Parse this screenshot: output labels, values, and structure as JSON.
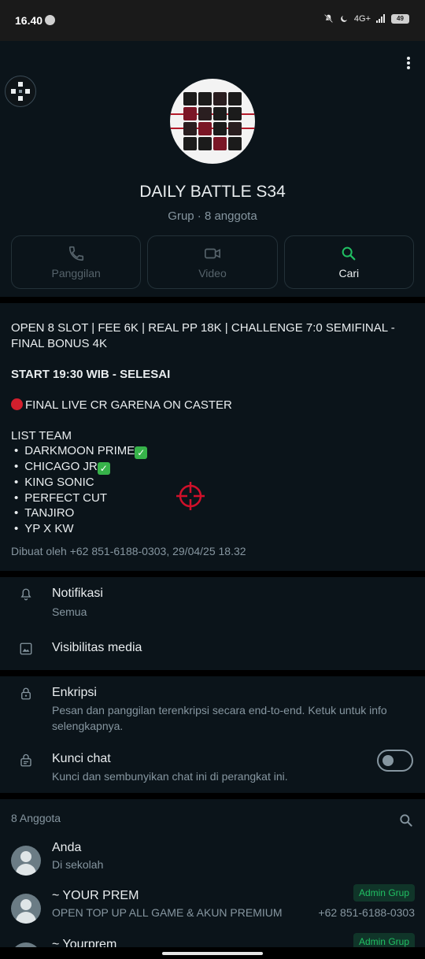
{
  "status_bar": {
    "time": "16.40",
    "battery": "49",
    "network": "4G+"
  },
  "header": {
    "group_name": "DAILY BATTLE S34",
    "group_sub": "Grup · 8 anggota"
  },
  "actions": [
    {
      "label": "Panggilan",
      "icon": "phone-icon",
      "enabled": false
    },
    {
      "label": "Video",
      "icon": "video-icon",
      "enabled": false
    },
    {
      "label": "Cari",
      "icon": "search-icon",
      "enabled": true
    }
  ],
  "description": {
    "line1": "OPEN 8 SLOT | FEE 6K | REAL PP 18K | CHALLENGE 7:0 SEMIFINAL - FINAL BONUS 4K",
    "start": "START 19:30 WIB - SELESAI",
    "final_live": "FINAL LIVE CR GARENA ON CASTER",
    "list_title": "LIST TEAM",
    "teams": [
      "DARKMOON PRIME",
      "CHICAGO JR",
      "KING SONIC",
      "PERFECT CUT",
      "TANJIRO",
      "YP X KW"
    ],
    "created_by": "Dibuat oleh +62 851-6188-0303, 29/04/25 18.32"
  },
  "settings": {
    "notifications": {
      "title": "Notifikasi",
      "sub": "Semua"
    },
    "media_visibility": {
      "title": "Visibilitas media"
    },
    "encryption": {
      "title": "Enkripsi",
      "sub": "Pesan dan panggilan terenkripsi secara end-to-end. Ketuk untuk info selengkapnya."
    },
    "chat_lock": {
      "title": "Kunci chat",
      "sub": "Kunci dan sembunyikan chat ini di perangkat ini.",
      "enabled": false
    }
  },
  "members": {
    "heading": "8 Anggota",
    "list": [
      {
        "name": "Anda",
        "status": "Di sekolah"
      },
      {
        "name": "~ YOUR PREM",
        "status": "OPEN TOP UP ALL GAME & AKUN PREMIUM",
        "badge": "Admin Grup",
        "phone": "+62 851-6188-0303"
      },
      {
        "name": "~ Yourprem",
        "badge": "Admin Grup"
      }
    ]
  },
  "colors": {
    "background": "#0b141a",
    "accent": "#21c063",
    "muted": "#8696a0"
  }
}
